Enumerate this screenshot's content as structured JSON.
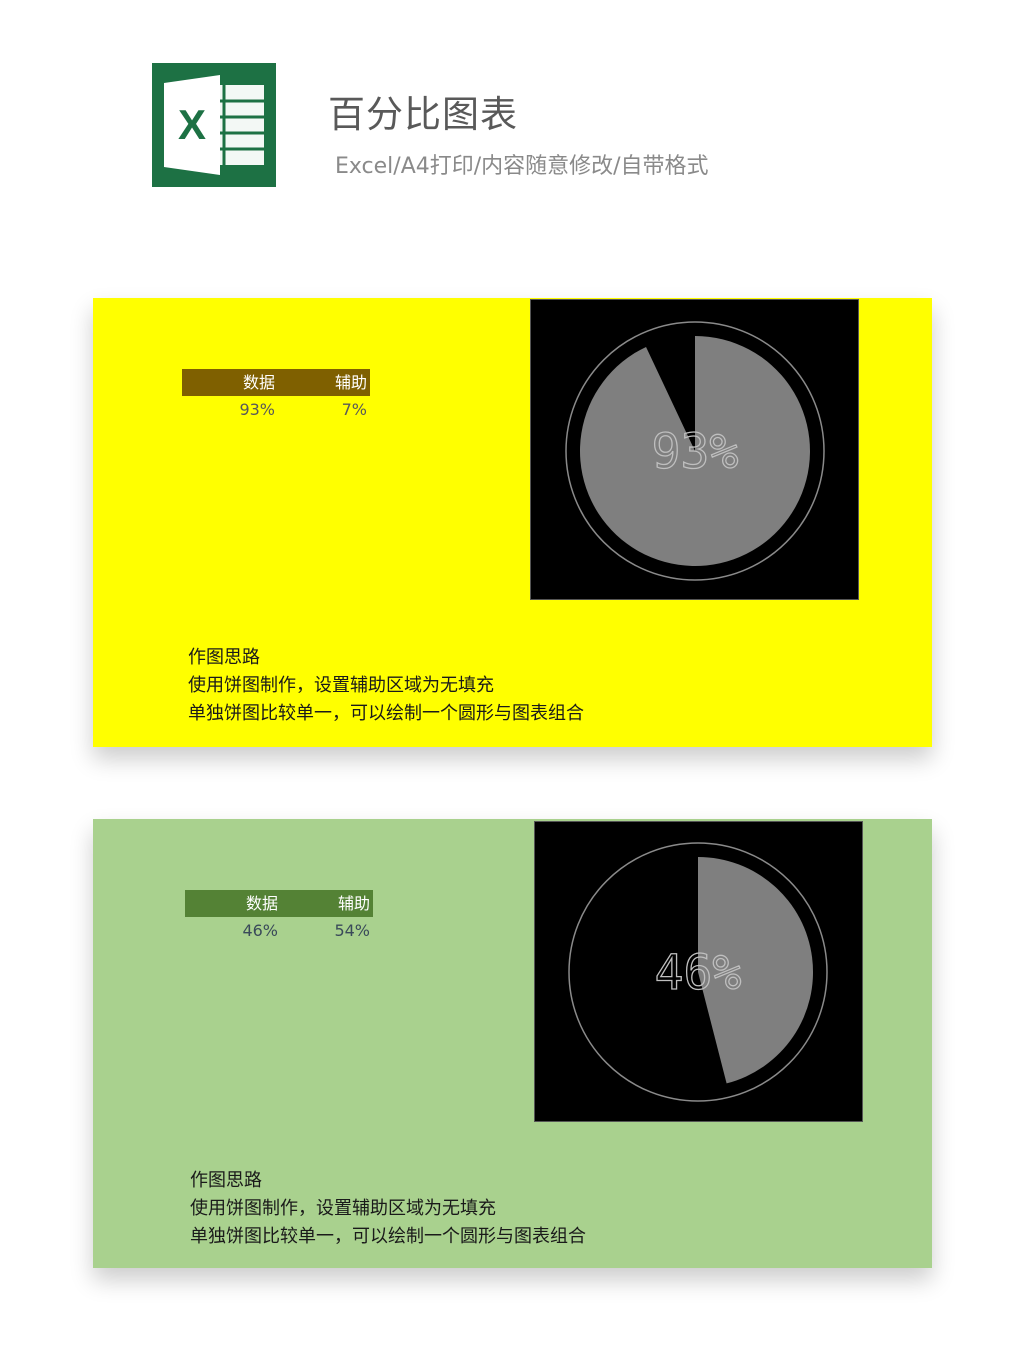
{
  "header": {
    "title": "百分比图表",
    "subtitle": "Excel/A4打印/内容随意修改/自带格式",
    "logo_letter": "X",
    "logo_icon": "excel-logo-icon",
    "logo_color": "#1D7144"
  },
  "panels": [
    {
      "background": "#FFFF00",
      "table": {
        "header_bg": "#7F6000",
        "value_color": "#595959",
        "headers": [
          "数据",
          "辅助"
        ],
        "values": [
          "93%",
          "7%"
        ]
      },
      "label": "93%",
      "notes": [
        "作图思路",
        "使用饼图制作，设置辅助区域为无填充",
        "单独饼图比较单一，可以绘制一个圆形与图表组合"
      ]
    },
    {
      "background": "#A9D18E",
      "table": {
        "header_bg": "#548235",
        "value_color": "#3A4A5A",
        "headers": [
          "数据",
          "辅助"
        ],
        "values": [
          "46%",
          "54%"
        ]
      },
      "label": "46%",
      "notes": [
        "作图思路",
        "使用饼图制作，设置辅助区域为无填充",
        "单独饼图比较单一，可以绘制一个圆形与图表组合"
      ]
    }
  ],
  "chart_data": [
    {
      "type": "pie",
      "categories": [
        "数据",
        "辅助"
      ],
      "values": [
        93,
        7
      ],
      "colors": [
        "#7F7F7F",
        "none"
      ],
      "center_label": "93%"
    },
    {
      "type": "pie",
      "categories": [
        "数据",
        "辅助"
      ],
      "values": [
        46,
        54
      ],
      "colors": [
        "#7F7F7F",
        "none"
      ],
      "center_label": "46%"
    }
  ]
}
